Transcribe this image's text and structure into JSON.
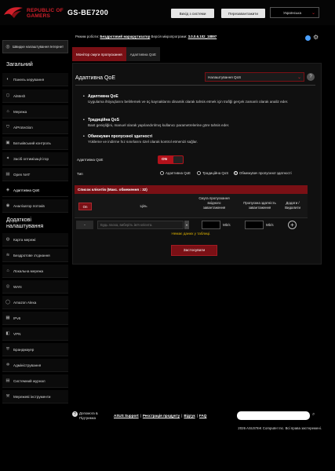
{
  "header": {
    "brand_line1": "REPUBLIC OF",
    "brand_line2": "GAMERS",
    "model": "GS-BE7200",
    "logout": "Вихід з системи",
    "reboot": "Перезавантажити",
    "language": "Українська"
  },
  "status": {
    "mode_label": "Режим роботи:",
    "mode_value": "Бездротовий маршрутизатор",
    "fw_label": "Версія мікропрограми:",
    "fw_value": "3.0.0.6.102_18897"
  },
  "sidebar": {
    "quick_setup": "Швидке налаштування Інтернет",
    "general_title": "Загальний",
    "general_items": [
      {
        "label": "Панель керування",
        "icon": "dashboard-icon"
      },
      {
        "label": "AiMesh",
        "icon": "mesh-icon"
      },
      {
        "label": "Мережа",
        "icon": "network-icon"
      },
      {
        "label": "AiProtection",
        "icon": "shield-icon"
      },
      {
        "label": "Батьківський контроль",
        "icon": "parental-icon"
      },
      {
        "label": "Засіб оптимізації ігор",
        "icon": "game-icon"
      },
      {
        "label": "Open NAT",
        "icon": "nat-icon"
      },
      {
        "label": "Адаптивна QoE",
        "icon": "qos-icon"
      },
      {
        "label": "Аналізатор потоків",
        "icon": "analyzer-icon"
      }
    ],
    "advanced_title_1": "Додаткові",
    "advanced_title_2": "налаштування",
    "advanced_items": [
      {
        "label": "Карта мережі",
        "icon": "map-icon"
      },
      {
        "label": "Бездротове з'єднання",
        "icon": "wireless-icon"
      },
      {
        "label": "Локальна мережа",
        "icon": "lan-icon"
      },
      {
        "label": "WAN",
        "icon": "wan-icon"
      },
      {
        "label": "Amazon Alexa",
        "icon": "alexa-icon"
      },
      {
        "label": "IPv6",
        "icon": "ipv6-icon"
      },
      {
        "label": "VPN",
        "icon": "vpn-icon"
      },
      {
        "label": "Брандмауер",
        "icon": "firewall-icon"
      },
      {
        "label": "Адміністрування",
        "icon": "admin-icon"
      },
      {
        "label": "Системний журнал",
        "icon": "log-icon"
      },
      {
        "label": "Мережеві інструменти",
        "icon": "tools-icon"
      }
    ]
  },
  "tabs": [
    "Монітор смуги пропускання",
    "Адаптивна QoE"
  ],
  "content": {
    "title": "Адаптивна QoE",
    "dropdown": "Налаштування QoS",
    "descriptions": [
      {
        "title": "Адаптивна QoE",
        "body": "Uygulama ihtiyaçlarını belirlemek ve üç kaynaklarını dinamik olarak tahsis etmek için trafiği gerçek zamanlı olarak analiz eder."
      },
      {
        "title": "Традиційна QoS",
        "body": "Bant genişliğini, manuel olarak yapılandırılmış kullanıcı parametrelerine göre tahsis eder."
      },
      {
        "title": "Обмежувач пропускної здатності",
        "body": "Yükleme ve indirme hız sınırlarını özel olarak kontrol etmenizi sağlar."
      }
    ],
    "enable_label": "Адаптивна QoE",
    "toggle_value": "ON",
    "type_label": "Тип",
    "radio_options": [
      "Адаптивна QoE",
      "Традиційна QoS",
      "Обмежувач пропускної здатності"
    ],
    "radio_selected_index": 2,
    "table": {
      "title": "Список клієнтів (Макс. обмеження : 32)",
      "on_button": "On",
      "col_target": "Ціль",
      "col_download_1": "Смуга пропускання",
      "col_download_2": "вхідного",
      "col_download_3": "завантаження",
      "col_upload_1": "Пропускна здатність",
      "col_upload_2": "завантаження",
      "col_add_1": "Додати /",
      "col_add_2": "Видалити",
      "row_minus": "-",
      "client_placeholder": "Будь ласка, виберіть ім'я клієнта.",
      "unit": "Mb/s",
      "no_data": "Немає даних у таблиці."
    },
    "apply": "Застосувати"
  },
  "footer": {
    "help_line1": "Допомога &",
    "help_line2": "Підтримка",
    "links": [
      "ASUS Support",
      "Реєстрація продукту",
      "Відгук",
      "FAQ"
    ],
    "copyright": "2026 ASUSTeK Computer Inc. Всі права застережені."
  },
  "colors": {
    "accent": "#b3121b",
    "dark_red": "#7a1015",
    "brand_red": "#d11f2a",
    "warning": "#e0b400"
  }
}
